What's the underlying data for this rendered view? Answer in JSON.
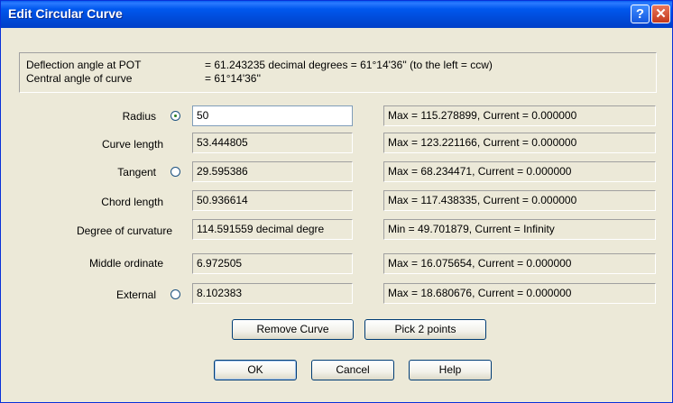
{
  "window": {
    "title": "Edit Circular Curve",
    "help_label": "?",
    "close_label": "✕"
  },
  "info": {
    "deflection_label": "Deflection angle at POT",
    "deflection_value": "= 61.243235 decimal degrees = 61°14'36'' (to the left = ccw)",
    "central_label": "Central angle of curve",
    "central_value": "= 61°14'36''"
  },
  "rows": {
    "radius": {
      "label": "Radius",
      "value": "50",
      "status": "Max = 115.278899, Current = 0.000000",
      "selected": true
    },
    "curve_length": {
      "label": "Curve length",
      "value": "53.444805",
      "status": "Max = 123.221166, Current = 0.000000"
    },
    "tangent": {
      "label": "Tangent",
      "value": "29.595386",
      "status": "Max = 68.234471, Current = 0.000000",
      "selected": false
    },
    "chord": {
      "label": "Chord length",
      "value": "50.936614",
      "status": "Max = 117.438335, Current = 0.000000"
    },
    "degree": {
      "label": "Degree of curvature",
      "value": "114.591559 decimal degre",
      "status": "Min = 49.701879, Current = Infinity"
    },
    "middle": {
      "label": "Middle ordinate",
      "value": "6.972505",
      "status": "Max = 16.075654, Current = 0.000000"
    },
    "external": {
      "label": "External",
      "value": "8.102383",
      "status": "Max = 18.680676, Current = 0.000000",
      "selected": false
    }
  },
  "buttons": {
    "remove_curve": "Remove Curve",
    "pick_points": "Pick 2 points",
    "ok": "OK",
    "cancel": "Cancel",
    "help": "Help"
  }
}
